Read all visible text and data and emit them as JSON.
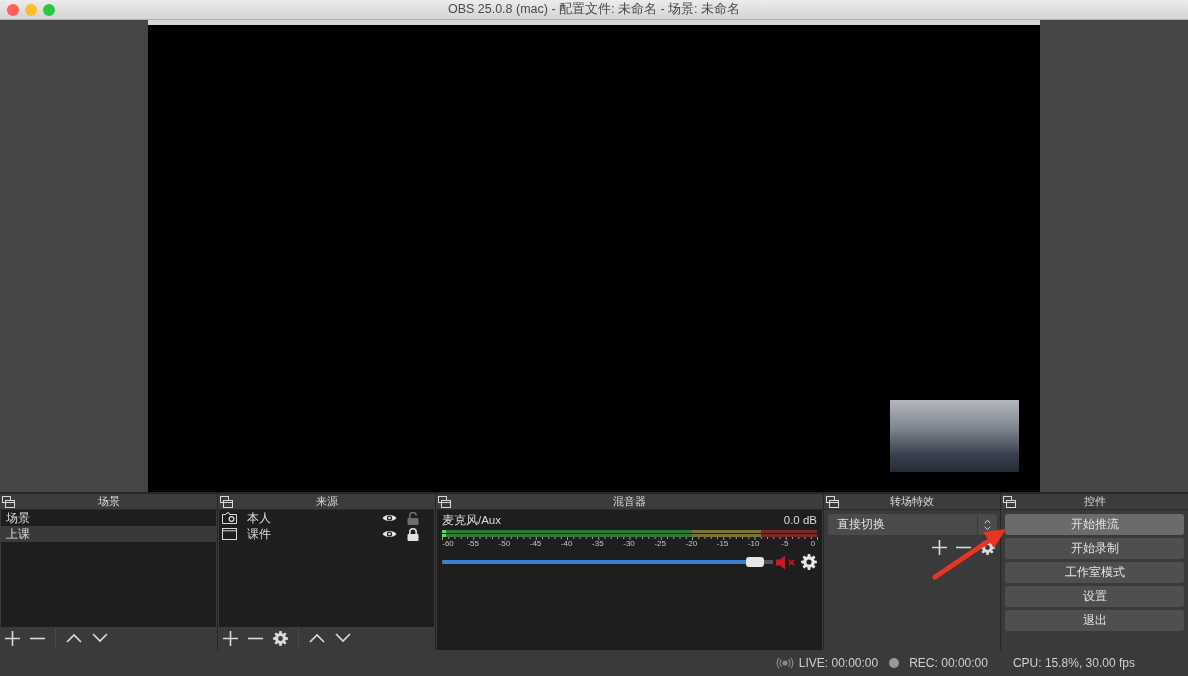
{
  "window": {
    "title": "OBS 25.0.8 (mac) - 配置文件: 未命名 - 场景: 未命名"
  },
  "scenes": {
    "title": "场景",
    "items": [
      {
        "label": "场景",
        "selected": false
      },
      {
        "label": "上课",
        "selected": true
      }
    ]
  },
  "sources": {
    "title": "来源",
    "items": [
      {
        "label": "本人",
        "kind": "camera",
        "visible": true,
        "locked": false
      },
      {
        "label": "课件",
        "kind": "window",
        "visible": true,
        "locked": true
      }
    ]
  },
  "mixer": {
    "title": "混音器",
    "channels": [
      {
        "name": "麦克风/Aux",
        "reading": "0.0 dB",
        "muted": true,
        "meter": {
          "level": 0.01
        },
        "scale": [
          "-60",
          "-55",
          "-50",
          "-45",
          "-40",
          "-35",
          "-30",
          "-25",
          "-20",
          "-15",
          "-10",
          "-5",
          "0"
        ],
        "volume": {
          "level": 0.97
        }
      }
    ]
  },
  "transitions": {
    "title": "转场特效",
    "value": "直接切换"
  },
  "controls": {
    "title": "控件",
    "buttons": [
      {
        "label": "开始推流",
        "highlighted": true
      },
      {
        "label": "开始录制",
        "highlighted": false
      },
      {
        "label": "工作室模式",
        "highlighted": false
      },
      {
        "label": "设置",
        "highlighted": false
      },
      {
        "label": "退出",
        "highlighted": false
      }
    ]
  },
  "status_bar": {
    "live": "LIVE: 00:00:00",
    "rec": "REC: 00:00:00",
    "cpu": "CPU: 15.8%, 30.00 fps"
  }
}
